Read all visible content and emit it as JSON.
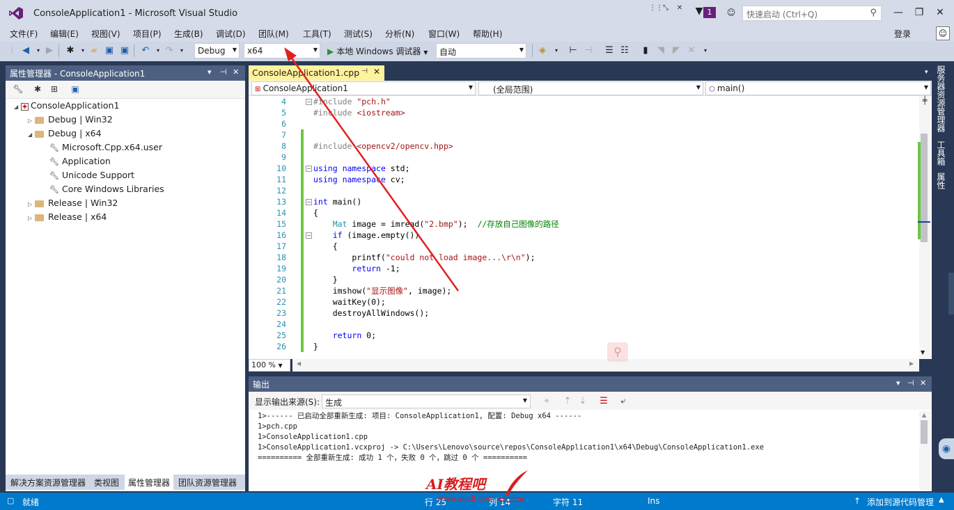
{
  "window": {
    "title": "ConsoleApplication1 - Microsoft Visual Studio",
    "notify_count": "1",
    "quick_launch_placeholder": "快速启动 (Ctrl+Q)"
  },
  "menu": {
    "items": [
      "文件(F)",
      "编辑(E)",
      "视图(V)",
      "项目(P)",
      "生成(B)",
      "调试(D)",
      "团队(M)",
      "工具(T)",
      "测试(S)",
      "分析(N)",
      "窗口(W)",
      "帮助(H)"
    ],
    "login": "登录"
  },
  "toolbar": {
    "config": "Debug",
    "platform": "x64",
    "run_label": "本地 Windows 调试器",
    "run_mode": "自动"
  },
  "property_manager": {
    "title": "属性管理器 - ConsoleApplication1",
    "tree": [
      {
        "label": "ConsoleApplication1",
        "level": 0,
        "expanded": true,
        "icon": "project-icon"
      },
      {
        "label": "Debug | Win32",
        "level": 1,
        "expanded": false,
        "icon": "folder-icon"
      },
      {
        "label": "Debug | x64",
        "level": 1,
        "expanded": true,
        "icon": "folder-icon"
      },
      {
        "label": "Microsoft.Cpp.x64.user",
        "level": 2,
        "icon": "wrench-icon"
      },
      {
        "label": "Application",
        "level": 2,
        "icon": "wrench-icon"
      },
      {
        "label": "Unicode Support",
        "level": 2,
        "icon": "wrench-icon"
      },
      {
        "label": "Core Windows Libraries",
        "level": 2,
        "icon": "wrench-icon"
      },
      {
        "label": "Release | Win32",
        "level": 1,
        "expanded": false,
        "icon": "folder-icon"
      },
      {
        "label": "Release | x64",
        "level": 1,
        "expanded": false,
        "icon": "folder-icon"
      }
    ],
    "tabs": [
      "解决方案资源管理器",
      "类视图",
      "属性管理器",
      "团队资源管理器"
    ]
  },
  "editor": {
    "tab": "ConsoleApplication1.cpp",
    "nav_project": "ConsoleApplication1",
    "nav_scope": "(全局范围)",
    "nav_member": "main()",
    "zoom": "100 %",
    "lines": [
      {
        "n": "4",
        "html": "<span class='pp'>#include</span> <span class='inc'>\"pch.h\"</span>"
      },
      {
        "n": "5",
        "html": "<span class='pp'>#include</span> <span class='inc'>&lt;iostream&gt;</span>"
      },
      {
        "n": "6",
        "html": ""
      },
      {
        "n": "7",
        "html": ""
      },
      {
        "n": "8",
        "html": "<span class='pp'>#include</span> <span class='inc'>&lt;opencv2/opencv.hpp&gt;</span>"
      },
      {
        "n": "9",
        "html": ""
      },
      {
        "n": "10",
        "html": "<span class='kw'>using</span> <span class='kw'>namespace</span> std;"
      },
      {
        "n": "11",
        "html": "<span class='kw'>using</span> <span class='kw'>namespace</span> cv;"
      },
      {
        "n": "12",
        "html": ""
      },
      {
        "n": "13",
        "html": "<span class='kw'>int</span> main()"
      },
      {
        "n": "14",
        "html": "{"
      },
      {
        "n": "15",
        "html": "    <span class='ty'>Mat</span> image = imread(<span class='st'>\"2.bmp\"</span>);  <span class='cm'>//存放自己图像的路径</span>"
      },
      {
        "n": "16",
        "html": "    <span class='kw'>if</span> (image.empty())"
      },
      {
        "n": "17",
        "html": "    {"
      },
      {
        "n": "18",
        "html": "        printf(<span class='st'>\"could not load image...\\r\\n\"</span>);"
      },
      {
        "n": "19",
        "html": "        <span class='kw'>return</span> -1;"
      },
      {
        "n": "20",
        "html": "    }"
      },
      {
        "n": "21",
        "html": "    imshow(<span class='st'>\"显示图像\"</span>, image);"
      },
      {
        "n": "22",
        "html": "    waitKey(0);"
      },
      {
        "n": "23",
        "html": "    destroyAllWindows();"
      },
      {
        "n": "24",
        "html": ""
      },
      {
        "n": "25",
        "html": "    <span class='kw'>return</span> 0;"
      },
      {
        "n": "26",
        "html": "}"
      }
    ]
  },
  "output": {
    "title": "输出",
    "source_label": "显示输出来源(S):",
    "source_value": "生成",
    "lines": [
      "1>------ 已启动全部重新生成: 项目: ConsoleApplication1, 配置: Debug x64 ------",
      "1>pch.cpp",
      "1>ConsoleApplication1.cpp",
      "1>ConsoleApplication1.vcxproj -> C:\\Users\\Lenovo\\source\\repos\\ConsoleApplication1\\x64\\Debug\\ConsoleApplication1.exe",
      "========== 全部重新生成: 成功 1 个，失败 0 个，跳过 0 个 =========="
    ]
  },
  "right_tabs": [
    "服务器资源管理器",
    "工具箱",
    "属性"
  ],
  "status": {
    "ready": "就绪",
    "line": "行 25",
    "col": "列 14",
    "char": "字符 11",
    "ins": "Ins",
    "source_control": "添加到源代码管理"
  },
  "watermark": {
    "text": "AI教程吧",
    "url": "www.aijc8.com"
  },
  "colors": {
    "accent": "#007acc",
    "panel_header": "#4d6082",
    "active_tab": "#fff29d",
    "arrow": "#e02020"
  }
}
